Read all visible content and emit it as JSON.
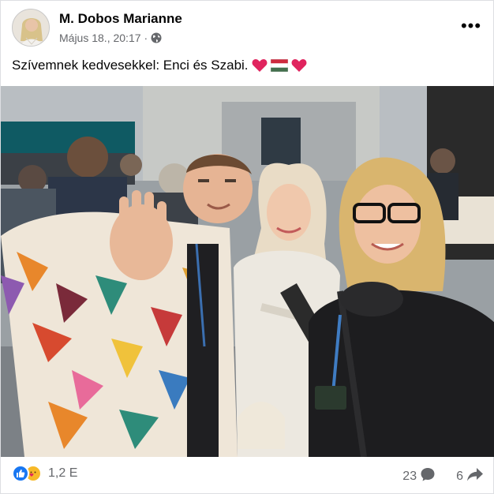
{
  "post": {
    "author": "M. Dobos Marianne",
    "timestamp": "Május 18., 20:17",
    "separator": "·",
    "audience_icon": "globe-icon",
    "more_label": "•••",
    "caption_text": "Szívemnek kedvesekkel: Enci és Szabi.",
    "caption_emoji": [
      "red-heart",
      "hungary-flag",
      "red-heart"
    ]
  },
  "footer": {
    "reaction_icons": [
      "like-icon",
      "care-icon"
    ],
    "reaction_count": "1,2 E",
    "comment_count": "23",
    "comment_icon": "comment-bubble-icon",
    "share_count": "6",
    "share_icon": "share-arrow-icon"
  },
  "colors": {
    "author_text": "#050505",
    "meta_text": "#65676b",
    "like_blue": "#1877f2",
    "care_yellow": "#f7b928",
    "heart_red": "#e0245e"
  }
}
